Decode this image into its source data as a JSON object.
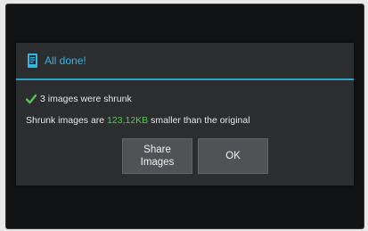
{
  "dialog": {
    "title": "All done!",
    "header_icon": "phone-doc-icon",
    "status_line": "3 images were shrunk",
    "status_icon": "checkmark-icon",
    "message_prefix": "Shrunk images are ",
    "message_highlight": "123,12KB",
    "message_suffix": " smaller than the original",
    "buttons": {
      "share_label_1": "Share",
      "share_label_2": "Images",
      "ok_label": "OK"
    }
  },
  "colors": {
    "accent": "#33b5e5",
    "highlight": "#5cc25c",
    "dialog_bg": "#2b2d2f",
    "screen_bg": "#121314"
  }
}
